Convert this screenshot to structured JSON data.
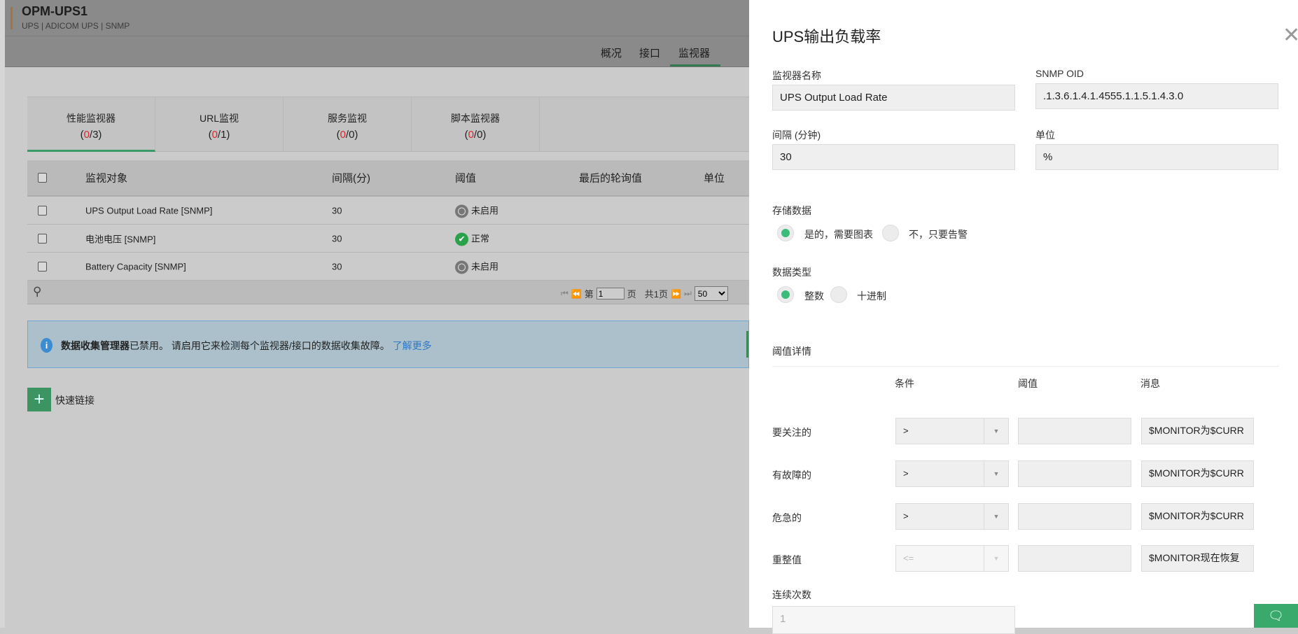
{
  "device": {
    "name": "OPM-UPS1",
    "subtitle": "UPS | ADICOM UPS | SNMP"
  },
  "nav": {
    "tabs": [
      "概况",
      "接口",
      "监视器"
    ],
    "active": "监视器"
  },
  "subtabs": [
    {
      "label": "性能监视器",
      "a": "0",
      "b": "3"
    },
    {
      "label": "URL监视",
      "a": "0",
      "b": "1"
    },
    {
      "label": "服务监视",
      "a": "0",
      "b": "0"
    },
    {
      "label": "脚本监视器",
      "a": "0",
      "b": "0"
    }
  ],
  "table": {
    "headers": [
      "监视对象",
      "间隔(分)",
      "阈值",
      "最后的轮询值",
      "单位"
    ],
    "rows": [
      {
        "name": "UPS Output Load Rate [SNMP]",
        "interval": "30",
        "threshold": "未启用",
        "status": "disabled"
      },
      {
        "name": "电池电压 [SNMP]",
        "interval": "30",
        "threshold": "正常",
        "status": "ok"
      },
      {
        "name": "Battery Capacity [SNMP]",
        "interval": "30",
        "threshold": "未启用",
        "status": "disabled"
      }
    ],
    "pager": {
      "page_prefix": "第",
      "page": "1",
      "page_suffix": "页",
      "total": "共1页",
      "per_page": "50"
    }
  },
  "info": {
    "bold": "数据收集管理器",
    "text": "已禁用。 请启用它来检测每个监视器/接口的数据收集故障。",
    "link": "了解更多"
  },
  "quick_links": "快速链接",
  "panel": {
    "title": "UPS输出负载率",
    "close": "✕",
    "monitor_name_label": "监视器名称",
    "monitor_name": "UPS Output Load Rate",
    "oid_label": "SNMP OID",
    "oid": ".1.3.6.1.4.1.4555.1.1.5.1.4.3.0",
    "interval_label": "间隔 (分钟)",
    "interval": "30",
    "unit_label": "单位",
    "unit": "%",
    "store_label": "存储数据",
    "store_yes": "是的，需要图表",
    "store_no": "不，只要告警",
    "type_label": "数据类型",
    "type_int": "整数",
    "type_dec": "十进制",
    "threshold_label": "阈值详情",
    "cols": [
      "条件",
      "阈值",
      "消息"
    ],
    "rows": [
      {
        "label": "要关注的",
        "cond": ">",
        "value": "",
        "message": "$MONITOR为$CURR"
      },
      {
        "label": "有故障的",
        "cond": ">",
        "value": "",
        "message": "$MONITOR为$CURR"
      },
      {
        "label": "危急的",
        "cond": ">",
        "value": "",
        "message": "$MONITOR为$CURR"
      },
      {
        "label": "重整值",
        "cond": "<=",
        "value": "",
        "message": "$MONITOR现在恢复"
      }
    ],
    "consecutive_label": "连续次数",
    "consecutive": "1"
  }
}
